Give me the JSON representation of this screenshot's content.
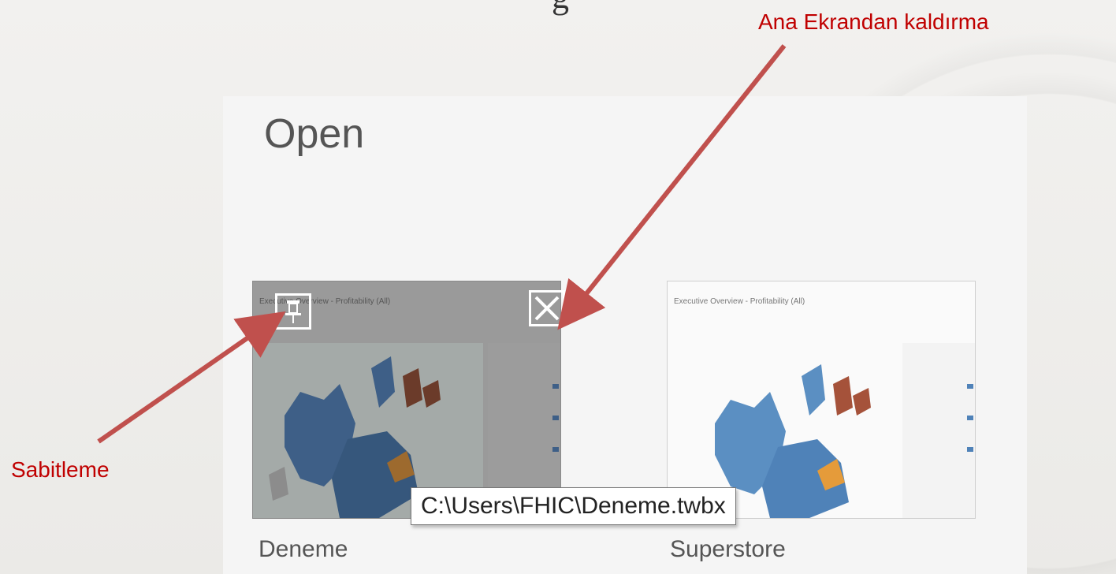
{
  "page": {
    "heading": "Open"
  },
  "files": [
    {
      "name": "Deneme",
      "path": "C:\\Users\\FHIC\\Deneme.twbx",
      "preview_title": "Executive Overview - Profitability (All)"
    },
    {
      "name": "Superstore",
      "preview_title": "Executive Overview - Profitability (All)"
    }
  ],
  "tooltip": {
    "text": "C:\\Users\\FHIC\\Deneme.twbx"
  },
  "annotations": {
    "remove": "Ana Ekrandan kaldırma",
    "pin": "Sabitleme",
    "color": "#c0504d"
  },
  "icons": {
    "pin": "pin-icon",
    "close": "close-icon"
  }
}
